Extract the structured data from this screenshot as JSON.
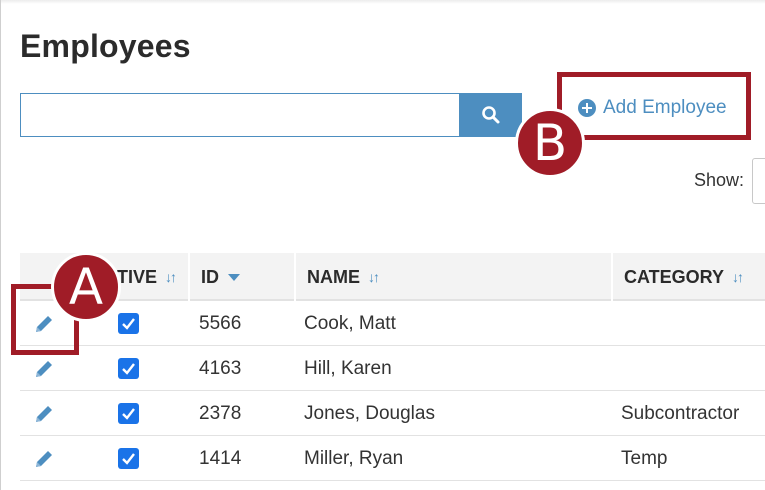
{
  "page": {
    "title": "Employees"
  },
  "search": {
    "value": "",
    "placeholder": ""
  },
  "actions": {
    "add_employee_label": "Add Employee"
  },
  "callouts": {
    "a": "A",
    "b": "B"
  },
  "pagination": {
    "show_label": "Show:"
  },
  "table": {
    "columns": [
      {
        "label": "TIVE",
        "sort": "unsorted"
      },
      {
        "label": "ID",
        "sort": "descending"
      },
      {
        "label": "NAME",
        "sort": "unsorted"
      },
      {
        "label": "CATEGORY",
        "sort": "unsorted"
      }
    ],
    "rows": [
      {
        "active": true,
        "id": "5566",
        "name": "Cook, Matt",
        "category": ""
      },
      {
        "active": true,
        "id": "4163",
        "name": "Hill, Karen",
        "category": ""
      },
      {
        "active": true,
        "id": "2378",
        "name": "Jones, Douglas",
        "category": "Subcontractor"
      },
      {
        "active": true,
        "id": "1414",
        "name": "Miller, Ryan",
        "category": "Temp"
      }
    ]
  },
  "colors": {
    "accent": "#4d8ec0",
    "callout": "#a01c27",
    "checkbox": "#1a73e8"
  }
}
